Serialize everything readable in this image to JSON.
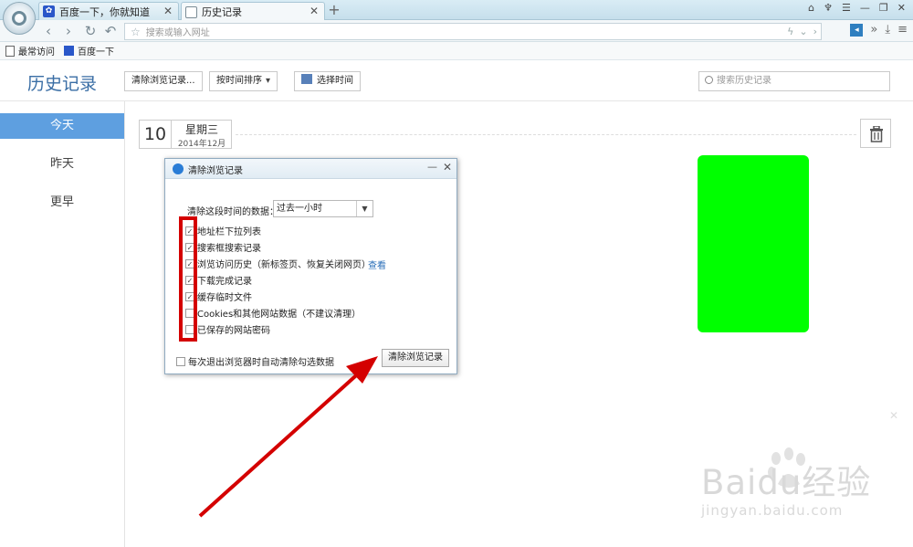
{
  "browser": {
    "tabs": [
      {
        "title": "百度一下，你就知道",
        "icon": "baidu-paw-icon"
      },
      {
        "title": "历史记录",
        "icon": "history-page-icon"
      }
    ],
    "address_placeholder": "搜索或输入网址",
    "bookmarks": [
      {
        "label": "最常访问",
        "icon": "page-icon"
      },
      {
        "label": "百度一下",
        "icon": "baidu-paw-icon"
      }
    ]
  },
  "history": {
    "title": "历史记录",
    "toolbar": {
      "clear_label": "清除浏览记录...",
      "sort_label": "按时间排序",
      "time_label": "选择时间"
    },
    "search_placeholder": "搜索历史记录",
    "sidebar": [
      {
        "label": "今天",
        "active": true
      },
      {
        "label": "昨天",
        "active": false
      },
      {
        "label": "更早",
        "active": false
      }
    ],
    "date": {
      "day": "10",
      "weekday": "星期三",
      "year_month": "2014年12月"
    }
  },
  "dialog": {
    "title": "清除浏览记录",
    "range_label": "清除这段时间的数据：",
    "range_value": "过去一小时",
    "options": [
      {
        "label": "地址栏下拉列表",
        "checked": true
      },
      {
        "label": "搜索框搜索记录",
        "checked": true
      },
      {
        "label": "浏览访问历史（新标签页、恢复关闭网页）",
        "checked": true
      },
      {
        "label": "下载完成记录",
        "checked": true
      },
      {
        "label": "缓存临时文件",
        "checked": true
      },
      {
        "label": "Cookies和其他网站数据（不建议清理）",
        "checked": false
      },
      {
        "label": "已保存的网站密码",
        "checked": false
      }
    ],
    "view_link": "查看",
    "auto_clear_label": "每次退出浏览器时自动清除勾选数据",
    "clear_button": "清除浏览记录"
  },
  "watermark": {
    "brand": "Baidu经验",
    "url": "jingyan.baidu.com"
  },
  "colors": {
    "accent": "#5e9fe0",
    "highlight_box": "#d40000",
    "green_block": "#00ff00"
  }
}
